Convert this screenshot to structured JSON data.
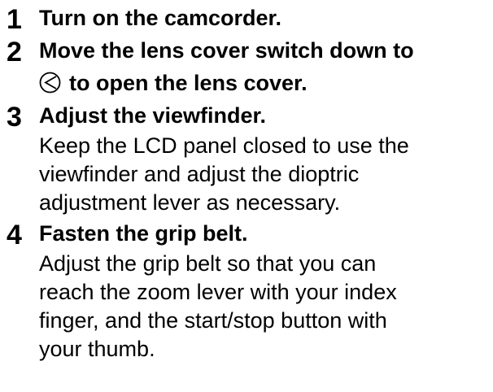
{
  "steps": [
    {
      "number": "1",
      "title": "Turn on the camcorder.",
      "body": []
    },
    {
      "number": "2",
      "title_line1": "Move the lens cover switch down to",
      "title_line2": "to open the lens cover.",
      "icon": "lens-cover-open-icon",
      "body": []
    },
    {
      "number": "3",
      "title": "Adjust the viewfinder.",
      "body": [
        "Keep the LCD panel closed to use the",
        "viewfinder and adjust the dioptric",
        "adjustment lever as necessary."
      ]
    },
    {
      "number": "4",
      "title": "Fasten the grip belt.",
      "body": [
        "Adjust the grip belt so that you can",
        "reach the zoom lever with your index",
        "finger, and the start/stop button with",
        "your thumb."
      ]
    }
  ]
}
